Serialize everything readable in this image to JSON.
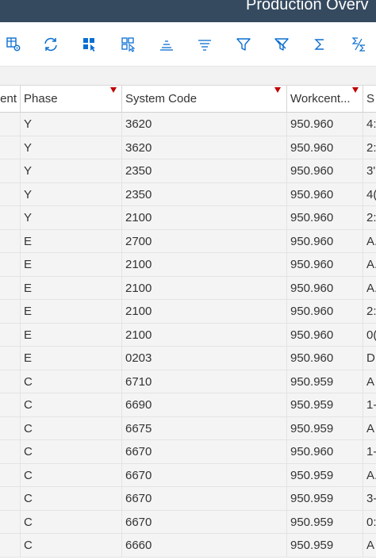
{
  "app": {
    "title": "Production Overv"
  },
  "toolbar": {
    "buttons": [
      {
        "name": "table-settings-icon",
        "label": ""
      },
      {
        "name": "refresh-icon",
        "label": ""
      },
      {
        "name": "select-layout-icon",
        "label": ""
      },
      {
        "name": "manage-layout-icon",
        "label": ""
      },
      {
        "name": "sort-ascending-icon",
        "label": ""
      },
      {
        "name": "sort-descending-icon",
        "label": ""
      },
      {
        "name": "filter-icon",
        "label": ""
      },
      {
        "name": "delete-filter-icon",
        "label": ""
      },
      {
        "name": "sum-icon",
        "label": ""
      },
      {
        "name": "subtotal-icon",
        "label": ""
      }
    ]
  },
  "table": {
    "columns": [
      "ent",
      "Phase",
      "System Code",
      "Workcent...",
      "S"
    ],
    "sorted_columns": [
      "Phase",
      "System Code",
      "Workcent..."
    ],
    "rows": [
      [
        "",
        "Y",
        "3620",
        "950.960",
        "4:"
      ],
      [
        "",
        "Y",
        "3620",
        "950.960",
        "2:"
      ],
      [
        "",
        "Y",
        "2350",
        "950.960",
        "3'"
      ],
      [
        "",
        "Y",
        "2350",
        "950.960",
        "4("
      ],
      [
        "",
        "Y",
        "2100",
        "950.960",
        "2:"
      ],
      [
        "",
        "E",
        "2700",
        "950.960",
        "A."
      ],
      [
        "",
        "E",
        "2100",
        "950.960",
        "A."
      ],
      [
        "",
        "E",
        "2100",
        "950.960",
        "A."
      ],
      [
        "",
        "E",
        "2100",
        "950.960",
        "2:"
      ],
      [
        "",
        "E",
        "2100",
        "950.960",
        "0("
      ],
      [
        "",
        "E",
        "0203",
        "950.960",
        "D"
      ],
      [
        "",
        "C",
        "6710",
        "950.959",
        "A"
      ],
      [
        "",
        "C",
        "6690",
        "950.959",
        "1-"
      ],
      [
        "",
        "C",
        "6675",
        "950.959",
        "A"
      ],
      [
        "",
        "C",
        "6670",
        "950.960",
        "1-"
      ],
      [
        "",
        "C",
        "6670",
        "950.959",
        "A."
      ],
      [
        "",
        "C",
        "6670",
        "950.959",
        "3-"
      ],
      [
        "",
        "C",
        "6670",
        "950.959",
        "0:"
      ],
      [
        "",
        "C",
        "6660",
        "950.959",
        "A"
      ]
    ]
  },
  "colors": {
    "titlebar": "#354a5f",
    "icon": "#0a6ed1",
    "sort_marker": "#c00000"
  }
}
